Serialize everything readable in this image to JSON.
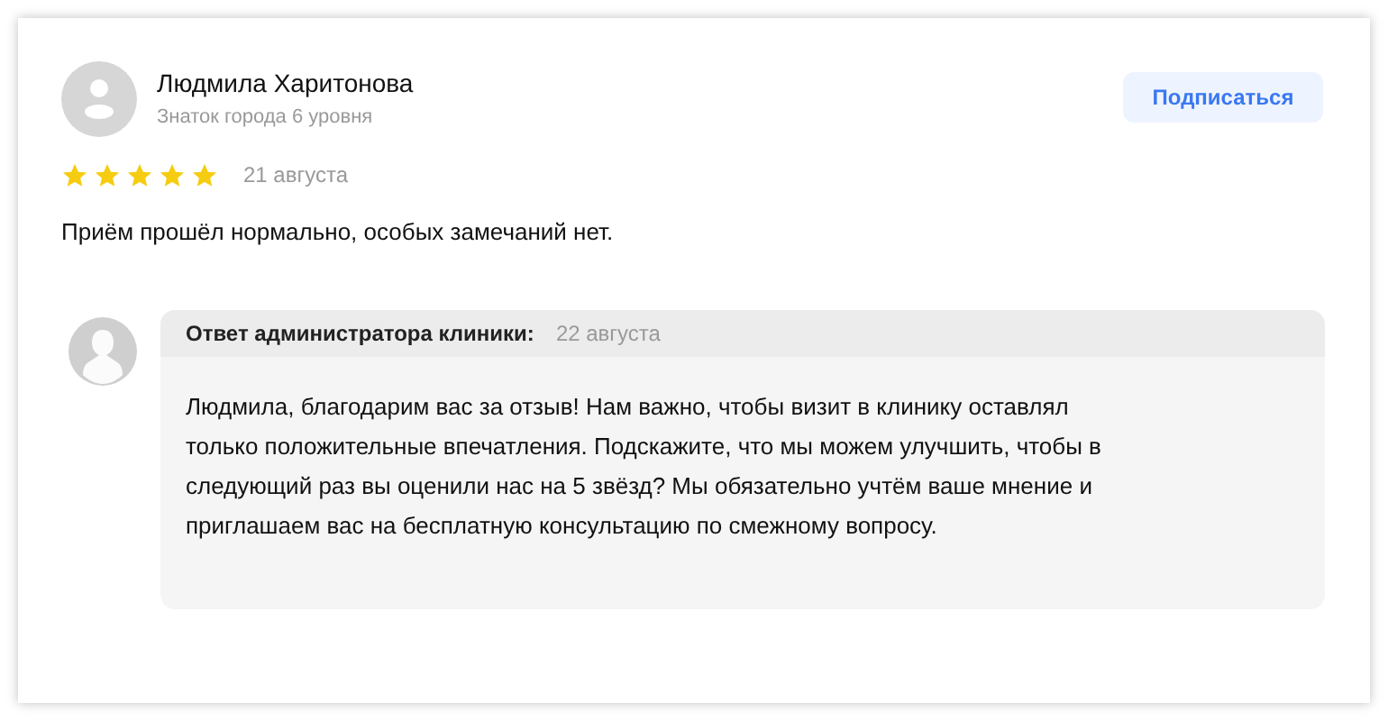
{
  "review": {
    "author": "Людмила Харитонова",
    "badge": "Знаток города 6 уровня",
    "stars": 5,
    "date": "21 августа",
    "text": "Приём прошёл нормально, особых замечаний нет."
  },
  "subscribe_button": "Подписаться",
  "reply": {
    "label": "Ответ администратора клиники:",
    "date": "22 августа",
    "text": "Людмила, благодарим вас за отзыв! Нам важно, чтобы визит в клинику оставлял только положительные впечатления. Подскажите, что мы можем улучшить, чтобы в следующий раз вы оценили нас на 5 звёзд? Мы обязательно учтём ваше мнение и приглашаем вас на бесплатную консультацию по смежному вопросу."
  }
}
